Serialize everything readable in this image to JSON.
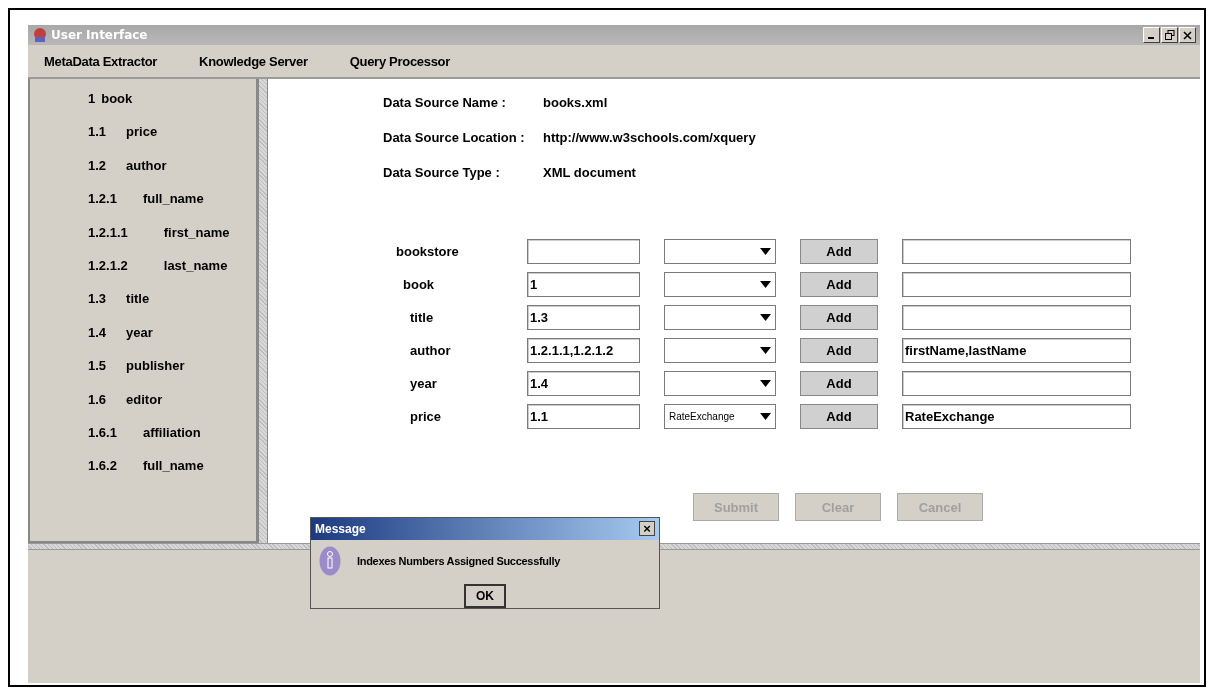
{
  "window": {
    "title": "User Interface"
  },
  "menu": [
    {
      "label": "MetaData Extractor"
    },
    {
      "label": "Knowledge Server"
    },
    {
      "label": "Query Processor"
    }
  ],
  "tree": [
    {
      "number": "1",
      "label": "book",
      "children": [
        {
          "number": "1.1",
          "label": "price"
        },
        {
          "number": "1.2",
          "label": "author",
          "children": [
            {
              "number": "1.2.1",
              "label": "full_name",
              "children": [
                {
                  "number": "1.2.1.1",
                  "label": "first_name"
                },
                {
                  "number": "1.2.1.2",
                  "label": "last_name"
                }
              ]
            }
          ]
        },
        {
          "number": "1.3",
          "label": "title"
        },
        {
          "number": "1.4",
          "label": "year"
        },
        {
          "number": "1.5",
          "label": "publisher"
        },
        {
          "number": "1.6",
          "label": "editor",
          "children": [
            {
              "number": "1.6.1",
              "label": "affiliation"
            },
            {
              "number": "1.6.2",
              "label": "full_name"
            }
          ]
        }
      ]
    }
  ],
  "source_info": [
    {
      "label": "Data Source Name :",
      "value": "books.xml"
    },
    {
      "label": "Data Source Location :",
      "value": "http://www.w3schools.com/xquery"
    },
    {
      "label": "Data Source Type :",
      "value": "XML document"
    }
  ],
  "mapping_rows": [
    {
      "label": "bookstore",
      "button": "Add",
      "children": [
        {
          "label": "book",
          "index": "1",
          "button": "Add",
          "children": [
            {
              "label": "title",
              "index": "1.3",
              "button": "Add"
            },
            {
              "label": "author",
              "index": "1.2.1.1,1.2.1.2",
              "button": "Add",
              "mapping": "firstName,lastName"
            },
            {
              "label": "year",
              "index": "1.4",
              "button": "Add"
            },
            {
              "label": "price",
              "index": "1.1",
              "dropdown": "RateExchange",
              "button": "Add",
              "mapping": "RateExchange"
            }
          ]
        }
      ]
    }
  ],
  "actions": [
    {
      "label": "Submit",
      "disabled": true
    },
    {
      "label": "Clear",
      "disabled": true
    },
    {
      "label": "Cancel",
      "disabled": true
    }
  ],
  "dialog": {
    "title": "Message",
    "close": "×",
    "message": "Indexes Numbers Assigned Successfully",
    "button": "OK"
  }
}
